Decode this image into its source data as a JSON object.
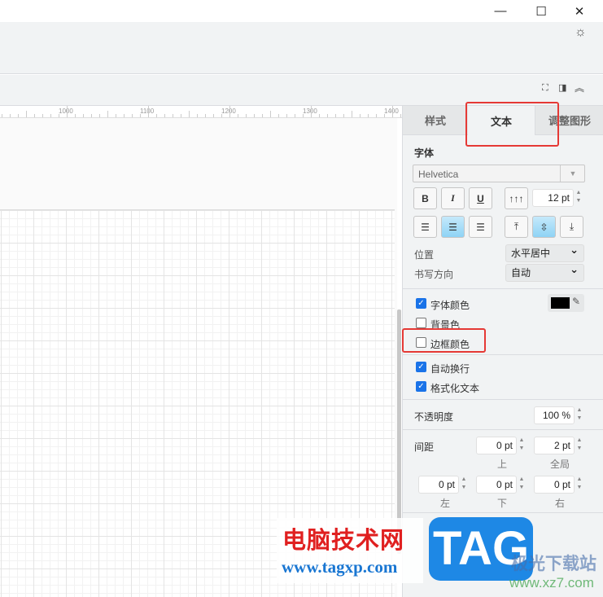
{
  "window": {
    "minimize_icon": "minimize-icon",
    "maximize_icon": "maximize-icon",
    "close_icon": "close-icon",
    "theme_icon": "sun-icon"
  },
  "ruler": {
    "labels": [
      "1000",
      "1100",
      "1200",
      "1300",
      "1400"
    ]
  },
  "panel": {
    "tabs": [
      {
        "label": "样式"
      },
      {
        "label": "文本",
        "active": true
      },
      {
        "label": "调整图形"
      }
    ],
    "font_section": "字体",
    "font_family": "Helvetica",
    "bold": "B",
    "italic": "I",
    "underline": "U",
    "font_size": "12 pt",
    "position_label": "位置",
    "position_value": "水平居中",
    "direction_label": "书写方向",
    "direction_value": "自动",
    "font_color": {
      "label": "字体颜色",
      "checked": true,
      "color": "#000000"
    },
    "bg_color": {
      "label": "背景色",
      "checked": false
    },
    "border_color": {
      "label": "边框颜色",
      "checked": false
    },
    "word_wrap": {
      "label": "自动换行",
      "checked": true
    },
    "formatted_text": {
      "label": "格式化文本",
      "checked": true
    },
    "opacity_label": "不透明度",
    "opacity_value": "100 %",
    "spacing_label": "间距",
    "spacing": {
      "top": "0 pt",
      "global": "2 pt",
      "left": "0 pt",
      "bottom": "0 pt",
      "right": "0 pt"
    },
    "spacing_labels": {
      "top": "上",
      "global": "全局",
      "left": "左",
      "bottom": "下",
      "right": "右"
    }
  },
  "watermark": {
    "site_cn": "电脑技术网",
    "site_url": "www.tagxp.com",
    "logo": "TAG",
    "site2_cn": "极光下载站",
    "site2_url": "www.xz7.com"
  },
  "highlight_color": "#e53935",
  "accent": "#1a73e8"
}
